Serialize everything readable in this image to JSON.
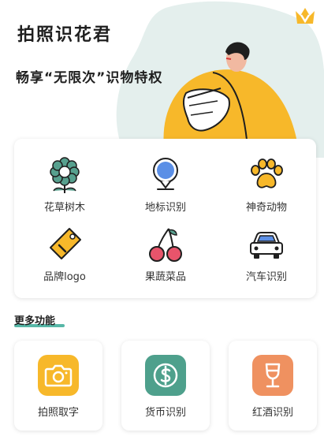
{
  "header": {
    "app_title": "拍照识花君",
    "subtitle": "畅享“无限次”识物特权",
    "vip_icon": "vip-crown-icon"
  },
  "main_grid": {
    "items": [
      {
        "label": "花草树木",
        "icon": "flower-icon"
      },
      {
        "label": "地标识别",
        "icon": "map-pin-icon"
      },
      {
        "label": "神奇动物",
        "icon": "paw-icon"
      },
      {
        "label": "品牌logo",
        "icon": "tag-icon"
      },
      {
        "label": "果蔬菜品",
        "icon": "cherry-icon"
      },
      {
        "label": "汽车识别",
        "icon": "car-icon"
      }
    ]
  },
  "more": {
    "title": "更多功能",
    "items": [
      {
        "label": "拍照取字",
        "icon": "camera-icon",
        "color": "#f7b82a"
      },
      {
        "label": "货币识别",
        "icon": "dollar-icon",
        "color": "#4ea08c"
      },
      {
        "label": "红酒识别",
        "icon": "wine-glass-icon",
        "color": "#ef9160"
      }
    ]
  },
  "colors": {
    "accent": "#57b7a7",
    "yellow": "#f7b82a",
    "bg_blob": "#e4efed"
  }
}
